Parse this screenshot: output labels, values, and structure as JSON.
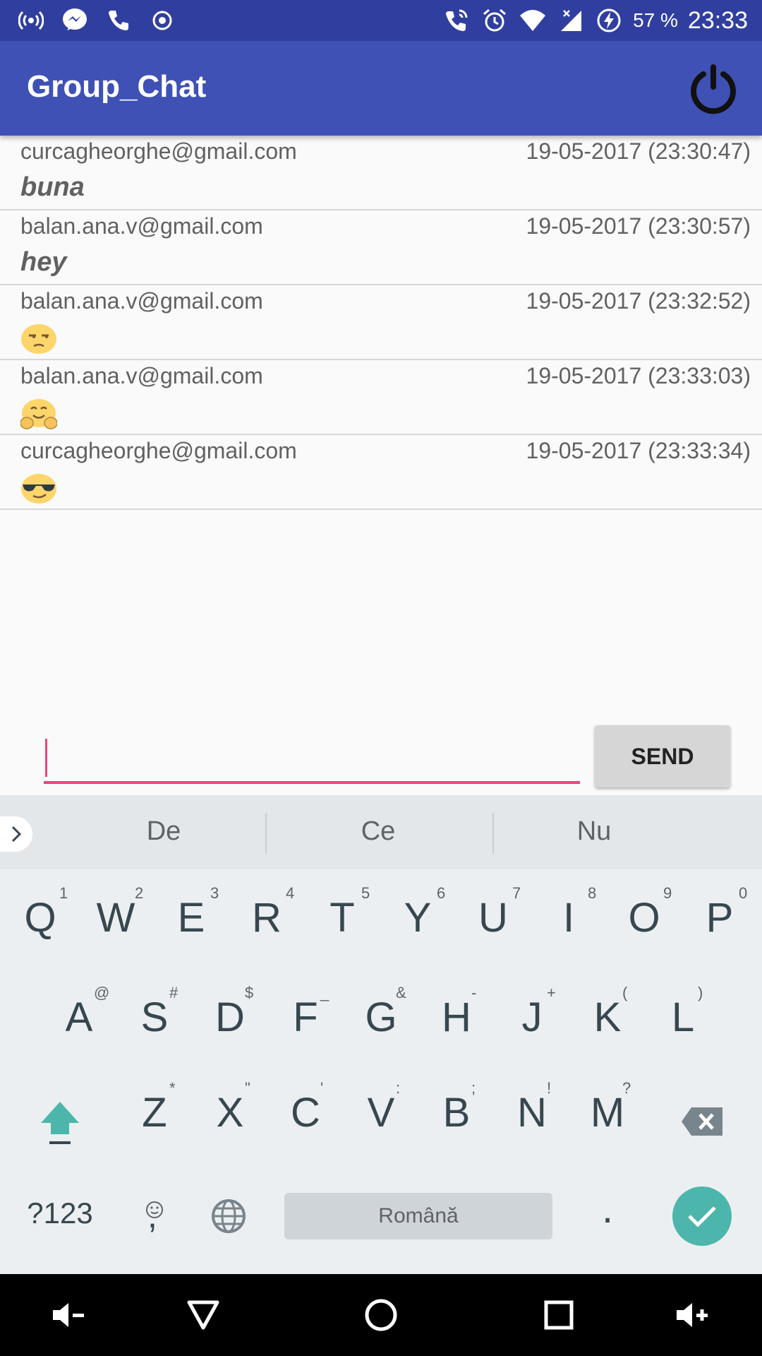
{
  "status_bar": {
    "battery_percent": "57 %",
    "time": "23:33",
    "left_icons": [
      "hotspot-icon",
      "messenger-icon",
      "phone-icon",
      "record-icon"
    ],
    "right_icons": [
      "wifi-call-icon",
      "alarm-icon",
      "wifi-icon",
      "signal-icon",
      "battery-charging-icon"
    ]
  },
  "app_bar": {
    "title": "Group_Chat",
    "power_icon": "power-icon"
  },
  "messages": [
    {
      "sender": "curcagheorghe@gmail.com",
      "time": "19-05-2017 (23:30:47)",
      "text": "buna",
      "emoji": ""
    },
    {
      "sender": "balan.ana.v@gmail.com",
      "time": "19-05-2017 (23:30:57)",
      "text": "hey",
      "emoji": ""
    },
    {
      "sender": "balan.ana.v@gmail.com",
      "time": "19-05-2017 (23:32:52)",
      "text": "",
      "emoji": "unamused-face"
    },
    {
      "sender": "balan.ana.v@gmail.com",
      "time": "19-05-2017 (23:33:03)",
      "text": "",
      "emoji": "hugging-face"
    },
    {
      "sender": "curcagheorghe@gmail.com",
      "time": "19-05-2017 (23:33:34)",
      "text": "",
      "emoji": "sunglasses-face"
    }
  ],
  "composer": {
    "input_value": "",
    "send_label": "SEND"
  },
  "keyboard": {
    "suggestions": [
      "De",
      "Ce",
      "Nu"
    ],
    "row1": [
      {
        "k": "Q",
        "h": "1"
      },
      {
        "k": "W",
        "h": "2"
      },
      {
        "k": "E",
        "h": "3"
      },
      {
        "k": "R",
        "h": "4"
      },
      {
        "k": "T",
        "h": "5"
      },
      {
        "k": "Y",
        "h": "6"
      },
      {
        "k": "U",
        "h": "7"
      },
      {
        "k": "I",
        "h": "8"
      },
      {
        "k": "O",
        "h": "9"
      },
      {
        "k": "P",
        "h": "0"
      }
    ],
    "row2": [
      {
        "k": "A",
        "h": "@"
      },
      {
        "k": "S",
        "h": "#"
      },
      {
        "k": "D",
        "h": "$"
      },
      {
        "k": "F",
        "h": "_"
      },
      {
        "k": "G",
        "h": "&"
      },
      {
        "k": "H",
        "h": "-"
      },
      {
        "k": "J",
        "h": "+"
      },
      {
        "k": "K",
        "h": "("
      },
      {
        "k": "L",
        "h": ")"
      }
    ],
    "row3": [
      {
        "k": "Z",
        "h": "*"
      },
      {
        "k": "X",
        "h": "\""
      },
      {
        "k": "C",
        "h": "'"
      },
      {
        "k": "V",
        "h": ":"
      },
      {
        "k": "B",
        "h": ";"
      },
      {
        "k": "N",
        "h": "!"
      },
      {
        "k": "M",
        "h": "?"
      }
    ],
    "symbols_label": "?123",
    "comma_label": ",",
    "period_label": ".",
    "space_label": "Română",
    "accent_color": "#4db6ac"
  },
  "nav_bar": {
    "icons": [
      "volume-down-icon",
      "back-icon",
      "home-icon",
      "recents-icon",
      "volume-up-icon"
    ]
  },
  "colors": {
    "status_bar": "#303f9f",
    "app_bar": "#3f51b5",
    "input_accent": "#e8467c"
  }
}
